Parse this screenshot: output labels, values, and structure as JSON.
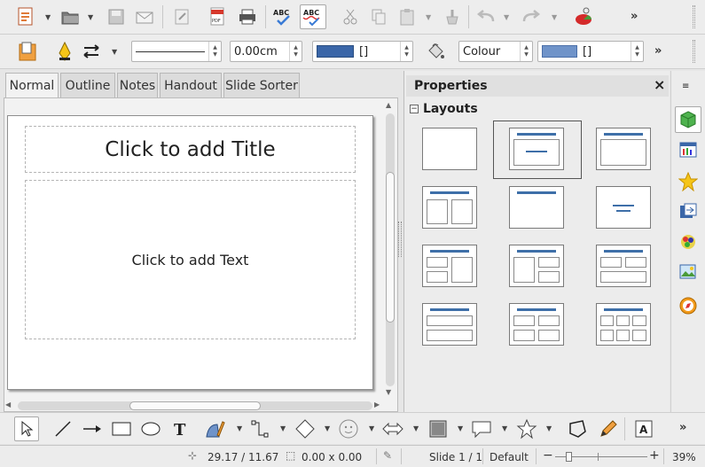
{
  "toolbar": {
    "font_size_value": "0.00cm",
    "line_color_value": "[]",
    "area_style_value": "Colour",
    "area_color_value": "[]",
    "more_label": "»"
  },
  "view_tabs": [
    {
      "label": "Normal",
      "selected": true
    },
    {
      "label": "Outline",
      "selected": false
    },
    {
      "label": "Notes",
      "selected": false
    },
    {
      "label": "Handout",
      "selected": false
    },
    {
      "label": "Slide Sorter",
      "selected": false
    }
  ],
  "slide": {
    "title_placeholder": "Click to add Title",
    "text_placeholder": "Click to add Text"
  },
  "sidebar": {
    "panel_title": "Properties",
    "close_label": "×",
    "section_label": "Layouts",
    "collapse_label": "−",
    "selected_layout_index": 1
  },
  "status": {
    "position": "29.17 / 11.67",
    "size": "0.00 x 0.00",
    "slide": "Slide 1 / 1",
    "master": "Default",
    "zoom": "39%",
    "zoom_minus": "−",
    "zoom_plus": "+"
  },
  "colors": {
    "line_color": "#3a66a8",
    "area_color": "#6f93c9",
    "layout_bar": "#3e6fa8"
  }
}
